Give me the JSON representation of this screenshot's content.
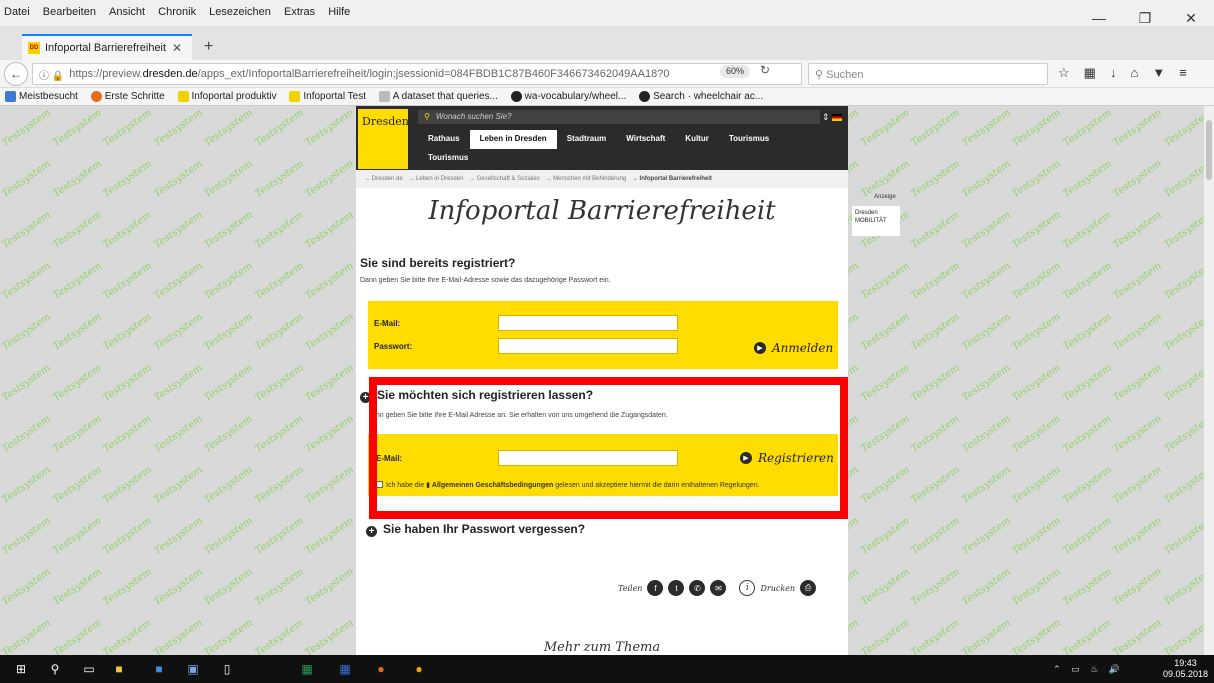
{
  "menubar": {
    "items": [
      "Datei",
      "Bearbeiten",
      "Ansicht",
      "Chronik",
      "Lesezeichen",
      "Extras",
      "Hilfe"
    ]
  },
  "tab": {
    "title": "Infoportal Barrierefreiheit",
    "favicon_text": "DD"
  },
  "urlbar": {
    "url_prefix": "https://preview.",
    "url_domain": "dresden.de",
    "url_rest": "/apps_ext/InfoportalBarrierefreiheit/login;jsessionid=084FBDB1C87B460F346673462049AA18?0",
    "zoom": "60%",
    "search_placeholder": "Suchen"
  },
  "bookmarks": [
    "Meistbesucht",
    "Erste Schritte",
    "Infoportal produktiv",
    "Infoportal Test",
    "A dataset that queries...",
    "wa-vocabulary/wheel...",
    "Search · wheelchair ac..."
  ],
  "watermark": "Testsystem",
  "site": {
    "logo_text": "Dresden.",
    "search_placeholder": "Wonach suchen Sie?",
    "nav": [
      "Rathaus",
      "Leben in Dresden",
      "Stadtraum",
      "Wirtschaft",
      "Kultur",
      "Tourismus",
      "Tourismus"
    ],
    "breadcrumb": [
      "Dresden.de",
      "Leben in Dresden",
      "Gesellschaft & Soziales",
      "Menschen mit Behinderung",
      "Infoportal Barrierefreiheit"
    ],
    "page_title": "Infoportal Barrierefreiheit"
  },
  "login": {
    "title": "Sie sind bereits registriert?",
    "text": "Dann geben Sie bitte Ihre E-Mail-Adresse sowie das dazugehörige Passwort ein.",
    "email_label": "E-Mail:",
    "password_label": "Passwort:",
    "button": "Anmelden"
  },
  "register": {
    "title": "Sie möchten sich registrieren lassen?",
    "text": "ann geben Sie bitte Ihre E-Mail Adresse an. Sie erhalten von uns umgehend die Zugangsdaten.",
    "email_label": "E-Mail:",
    "button": "Registrieren",
    "agb_prefix": "Ich habe die",
    "agb_link": "Allgemeinen Geschäftsbedingungen",
    "agb_suffix": "gelesen und akzeptiere hiermit die darin enthaltenen Regelungen."
  },
  "forgot": {
    "title": "Sie haben Ihr Passwort vergessen?"
  },
  "share": {
    "label": "Teilen",
    "print": "Drucken"
  },
  "more": {
    "title": "Mehr zum Thema"
  },
  "ad": {
    "label": "Anzeige",
    "line1": "Dresden",
    "line2": "MOBILITÄT"
  },
  "clock": {
    "time": "19:43",
    "date": "09.05.2018"
  },
  "colors": {
    "highlight": "#ff0000",
    "brand_yellow": "#ffdd00",
    "watermark": "#8fd16a"
  }
}
